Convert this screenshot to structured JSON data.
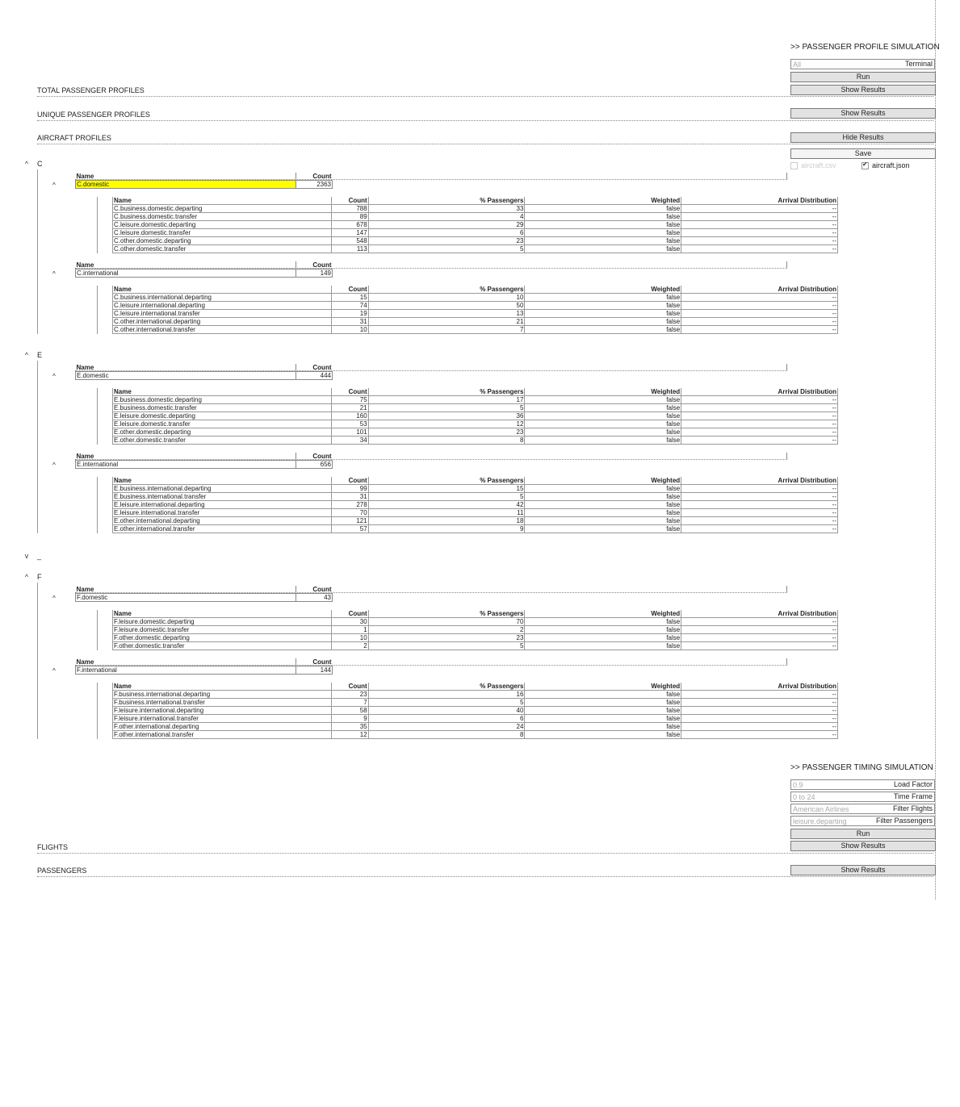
{
  "profile_sim": {
    "title": ">> PASSENGER PROFILE SIMULATION",
    "terminal_placeholder": "All",
    "terminal_label": "Terminal",
    "run": "Run",
    "show_results_total": "Show Results",
    "show_results_unique": "Show Results",
    "hide_results_aircraft": "Hide Results",
    "save": "Save",
    "aircraft_csv": "aircraft.csv",
    "aircraft_json": "aircraft.json"
  },
  "sections": {
    "total": "TOTAL PASSENGER PROFILES",
    "unique": "UNIQUE PASSENGER PROFILES",
    "aircraft": "AIRCRAFT PROFILES",
    "flights": "FLIGHTS",
    "passengers": "PASSENGERS"
  },
  "table_headers": {
    "name": "Name",
    "count": "Count",
    "pct": "% Passengers",
    "weighted": "Weighted",
    "arrival": "Arrival Distribution"
  },
  "groups": [
    {
      "title": "C",
      "classes": [
        {
          "name": "C.domestic",
          "count": "2363",
          "selected": true,
          "rows": [
            [
              "C.business.domestic.departing",
              "788",
              "33",
              "false",
              "--"
            ],
            [
              "C.business.domestic.transfer",
              "89",
              "4",
              "false",
              "--"
            ],
            [
              "C.leisure.domestic.departing",
              "678",
              "29",
              "false",
              "--"
            ],
            [
              "C.leisure.domestic.transfer",
              "147",
              "6",
              "false",
              "--"
            ],
            [
              "C.other.domestic.departing",
              "548",
              "23",
              "false",
              "--"
            ],
            [
              "C.other.domestic.transfer",
              "113",
              "5",
              "false",
              "--"
            ]
          ]
        },
        {
          "name": "C.international",
          "count": "149",
          "selected": false,
          "rows": [
            [
              "C.business.international.departing",
              "15",
              "10",
              "false",
              "--"
            ],
            [
              "C.leisure.international.departing",
              "74",
              "50",
              "false",
              "--"
            ],
            [
              "C.leisure.international.transfer",
              "19",
              "13",
              "false",
              "--"
            ],
            [
              "C.other.international.departing",
              "31",
              "21",
              "false",
              "--"
            ],
            [
              "C.other.international.transfer",
              "10",
              "7",
              "false",
              "--"
            ]
          ]
        }
      ]
    },
    {
      "title": "E",
      "classes": [
        {
          "name": "E.domestic",
          "count": "444",
          "selected": false,
          "rows": [
            [
              "E.business.domestic.departing",
              "75",
              "17",
              "false",
              "--"
            ],
            [
              "E.business.domestic.transfer",
              "21",
              "5",
              "false",
              "--"
            ],
            [
              "E.leisure.domestic.departing",
              "160",
              "36",
              "false",
              "--"
            ],
            [
              "E.leisure.domestic.transfer",
              "53",
              "12",
              "false",
              "--"
            ],
            [
              "E.other.domestic.departing",
              "101",
              "23",
              "false",
              "--"
            ],
            [
              "E.other.domestic.transfer",
              "34",
              "8",
              "false",
              "--"
            ]
          ]
        },
        {
          "name": "E.international",
          "count": "656",
          "selected": false,
          "rows": [
            [
              "E.business.international.departing",
              "99",
              "15",
              "false",
              "--"
            ],
            [
              "E.business.international.transfer",
              "31",
              "5",
              "false",
              "--"
            ],
            [
              "E.leisure.international.departing",
              "278",
              "42",
              "false",
              "--"
            ],
            [
              "E.leisure.international.transfer",
              "70",
              "11",
              "false",
              "--"
            ],
            [
              "E.other.international.departing",
              "121",
              "18",
              "false",
              "--"
            ],
            [
              "E.other.international.transfer",
              "57",
              "9",
              "false",
              "--"
            ]
          ]
        }
      ]
    },
    {
      "title": "F",
      "classes": [
        {
          "name": "F.domestic",
          "count": "43",
          "selected": false,
          "rows": [
            [
              "F.leisure.domestic.departing",
              "30",
              "70",
              "false",
              "--"
            ],
            [
              "F.leisure.domestic.transfer",
              "1",
              "2",
              "false",
              "--"
            ],
            [
              "F.other.domestic.departing",
              "10",
              "23",
              "false",
              "--"
            ],
            [
              "F.other.domestic.transfer",
              "2",
              "5",
              "false",
              "--"
            ]
          ]
        },
        {
          "name": "F.international",
          "count": "144",
          "selected": false,
          "rows": [
            [
              "F.business.international.departing",
              "23",
              "16",
              "false",
              "--"
            ],
            [
              "F.business.international.transfer",
              "7",
              "5",
              "false",
              "--"
            ],
            [
              "F.leisure.international.departing",
              "58",
              "40",
              "false",
              "--"
            ],
            [
              "F.leisure.international.transfer",
              "9",
              "6",
              "false",
              "--"
            ],
            [
              "F.other.international.departing",
              "35",
              "24",
              "false",
              "--"
            ],
            [
              "F.other.international.transfer",
              "12",
              "8",
              "false",
              "--"
            ]
          ]
        }
      ]
    }
  ],
  "collapsed_group": {
    "title": "_"
  },
  "timing_sim": {
    "title": ">> PASSENGER TIMING SIMULATION",
    "load_factor_placeholder": "0.9",
    "load_factor_label": "Load Factor",
    "time_frame_placeholder": "0 to 24",
    "time_frame_label": "Time Frame",
    "filter_flights_placeholder": "American Airlines",
    "filter_flights_label": "Filter Flights",
    "filter_passengers_placeholder": "leisure.departing",
    "filter_passengers_label": "Filter Passengers",
    "run": "Run",
    "show_results_flights": "Show Results",
    "show_results_passengers": "Show Results"
  }
}
